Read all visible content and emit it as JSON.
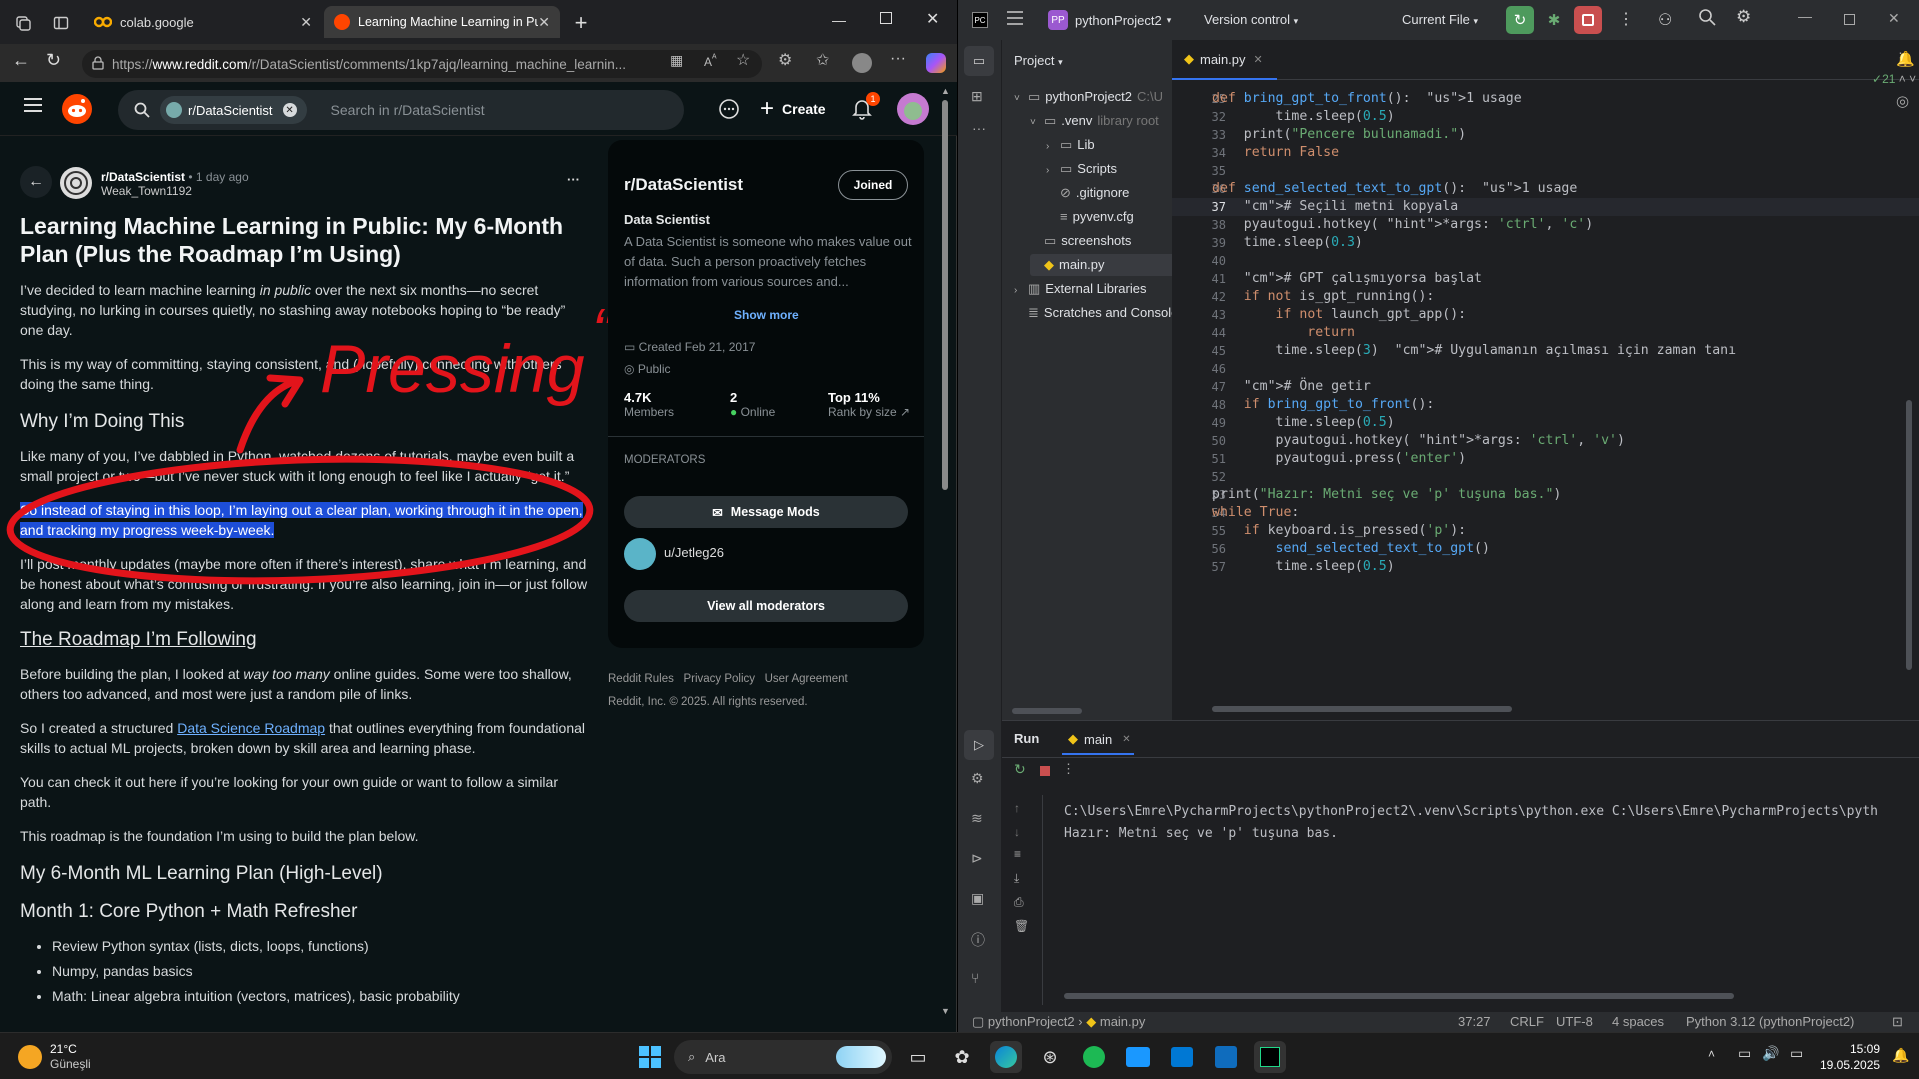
{
  "browser": {
    "tabs": [
      {
        "label": "colab.google",
        "active": false
      },
      {
        "label": "Learning Machine Learning in Pul",
        "active": true
      }
    ],
    "url": {
      "prefix": "https://",
      "domain": "www.reddit.com",
      "path": "/r/DataScientist/comments/1kp7ajq/learning_machine_learnin..."
    }
  },
  "reddit": {
    "subreddit_chip": "r/DataScientist",
    "search_placeholder": "Search in r/DataScientist",
    "create_label": "Create",
    "notif_count": "1",
    "post": {
      "subreddit": "r/DataScientist",
      "time": "• 1 day ago",
      "author": "Weak_Town1192",
      "title": "Learning Machine Learning in Public: My 6-Month Plan (Plus the Roadmap I’m Using)",
      "p1a": "I’ve decided to learn machine learning ",
      "p1em": "in public",
      "p1b": " over the next six months—no secret studying, no lurking in courses quietly, no stashing away notebooks hoping to “be ready” one day.",
      "p2": "This is my way of committing, staying consistent, and (hopefully) connecting with others doing the same thing.",
      "h_why": "Why I’m Doing This",
      "p3": "Like many of you, I’ve dabbled in Python, watched dozens of tutorials, maybe even built a small project or two—but I’ve never stuck with it long enough to feel like I actually “get it.”",
      "p4": "So instead of staying in this loop, I’m laying out a clear plan, working through it in the open, and tracking my progress week-by-week.",
      "p5": "I’ll post monthly updates (maybe more often if there’s interest), share what I’m learning, and be honest about what’s confusing or frustrating. If you’re also learning, join in—or just follow along and learn from my mistakes.",
      "h_roadmap": "The Roadmap I’m Following",
      "p6a": "Before building the plan, I looked at ",
      "p6em": "way too many",
      "p6b": " online guides. Some were too shallow, others too advanced, and most were just a random pile of links.",
      "p7a": "So I created a structured ",
      "p7link": "Data Science Roadmap",
      "p7b": " that outlines everything from foundational skills to actual ML projects, broken down by skill area and learning phase.",
      "p8": "You can check it out here if you’re looking for your own guide or want to follow a similar path.",
      "p9": "This roadmap is the foundation I’m using to build the plan below.",
      "h_plan": "My 6-Month ML Learning Plan (High-Level)",
      "h_month1": "Month 1: Core Python + Math Refresher",
      "bullets": [
        "Review Python syntax (lists, dicts, loops, functions)",
        "Numpy, pandas basics",
        "Math: Linear algebra intuition (vectors, matrices), basic probability"
      ]
    },
    "sidebar": {
      "name": "r/DataScientist",
      "joined": "Joined",
      "subtitle": "Data Scientist",
      "desc": "A Data Scientist is someone who makes value out of data. Such a person proactively fetches information from various sources and...",
      "show_more": "Show more",
      "created": "Created Feb 21, 2017",
      "visibility": "Public",
      "members_val": "4.7K",
      "members_label": "Members",
      "online_val": "2",
      "online_label": "Online",
      "rank_val": "Top 11%",
      "rank_label": "Rank by size",
      "moderators_heading": "MODERATORS",
      "message_mods": "Message Mods",
      "mod_name": "u/Jetleg26",
      "view_all": "View all moderators"
    },
    "footer": {
      "rules": "Reddit Rules",
      "privacy": "Privacy Policy",
      "agreement": "User Agreement",
      "copyright": "Reddit, Inc. © 2025. All rights reserved."
    },
    "annotation": {
      "text1": "Pressing",
      "text2": "“p”"
    }
  },
  "ide": {
    "project_badge": "PP",
    "project_name": "pythonProject2",
    "vcs": "Version control",
    "run_config": "Current File",
    "tool_title": "Project",
    "tree": [
      {
        "label": "pythonProject2",
        "suffix": "C:\\U",
        "indent": 0,
        "icon": "folder",
        "chev": "down"
      },
      {
        "label": ".venv",
        "suffix": "library root",
        "indent": 1,
        "icon": "folder",
        "chev": "down"
      },
      {
        "label": "Lib",
        "suffix": "",
        "indent": 2,
        "icon": "folder",
        "chev": "right"
      },
      {
        "label": "Scripts",
        "suffix": "",
        "indent": 2,
        "icon": "folder",
        "chev": "right"
      },
      {
        "label": ".gitignore",
        "suffix": "",
        "indent": 2,
        "icon": "ignore",
        "chev": ""
      },
      {
        "label": "pyvenv.cfg",
        "suffix": "",
        "indent": 2,
        "icon": "file",
        "chev": ""
      },
      {
        "label": "screenshots",
        "suffix": "",
        "indent": 1,
        "icon": "folder",
        "chev": ""
      },
      {
        "label": "main.py",
        "suffix": "",
        "indent": 1,
        "icon": "py",
        "chev": ""
      },
      {
        "label": "External Libraries",
        "suffix": "",
        "indent": 0,
        "icon": "lib",
        "chev": "right"
      },
      {
        "label": "Scratches and Consoles",
        "suffix": "",
        "indent": 0,
        "icon": "scratch",
        "chev": ""
      }
    ],
    "editor_tab": "main.py",
    "inspection_count": "21",
    "line_numbers": [
      "25",
      "32",
      "33",
      "34",
      "35",
      "36",
      "37",
      "38",
      "39",
      "40",
      "41",
      "42",
      "43",
      "44",
      "45",
      "46",
      "47",
      "48",
      "49",
      "50",
      "51",
      "52",
      "53",
      "54",
      "55",
      "56",
      "57"
    ],
    "code_lines": [
      "def bring_gpt_to_front():  1 usage",
      "        time.sleep(0.5)",
      "    print(\"Pencere bulunamadi.\")",
      "    return False",
      "",
      "def send_selected_text_to_gpt():  1 usage",
      "    # Seçili metni kopyala",
      "    pyautogui.hotkey( *args: 'ctrl', 'c')",
      "    time.sleep(0.3)",
      "",
      "    # GPT çalışmıyorsa başlat",
      "    if not is_gpt_running():",
      "        if not launch_gpt_app():",
      "            return",
      "        time.sleep(3)  # Uygulamanın açılması için zaman tanı",
      "",
      "    # Öne getir",
      "    if bring_gpt_to_front():",
      "        time.sleep(0.5)",
      "        pyautogui.hotkey( *args: 'ctrl', 'v')",
      "        pyautogui.press('enter')",
      "",
      "print(\"Hazır: Metni seç ve 'p' tuşuna bas.\")",
      "while True:",
      "    if keyboard.is_pressed('p'):",
      "        send_selected_text_to_gpt()",
      "        time.sleep(0.5)"
    ],
    "run": {
      "title": "Run",
      "tab": "main",
      "out1": "C:\\Users\\Emre\\PycharmProjects\\pythonProject2\\.venv\\Scripts\\python.exe C:\\Users\\Emre\\PycharmProjects\\pyth",
      "out2": "Hazır: Metni seç ve 'p' tuşuna bas."
    },
    "status": {
      "project": "pythonProject2",
      "file": "main.py",
      "pos": "37:27",
      "eol": "CRLF",
      "enc": "UTF-8",
      "indent": "4 spaces",
      "interp": "Python 3.12 (pythonProject2)"
    }
  },
  "taskbar": {
    "temp": "21°C",
    "weather": "Güneşli",
    "search": "Ara",
    "time": "15:09",
    "date": "19.05.2025"
  },
  "colors": {
    "reddit_orange": "#ff4500",
    "highlight": "#1d4ed8",
    "ink": "#e3141b",
    "pycharm_green": "#4e9a5d",
    "stop_red": "#c94f4f"
  }
}
